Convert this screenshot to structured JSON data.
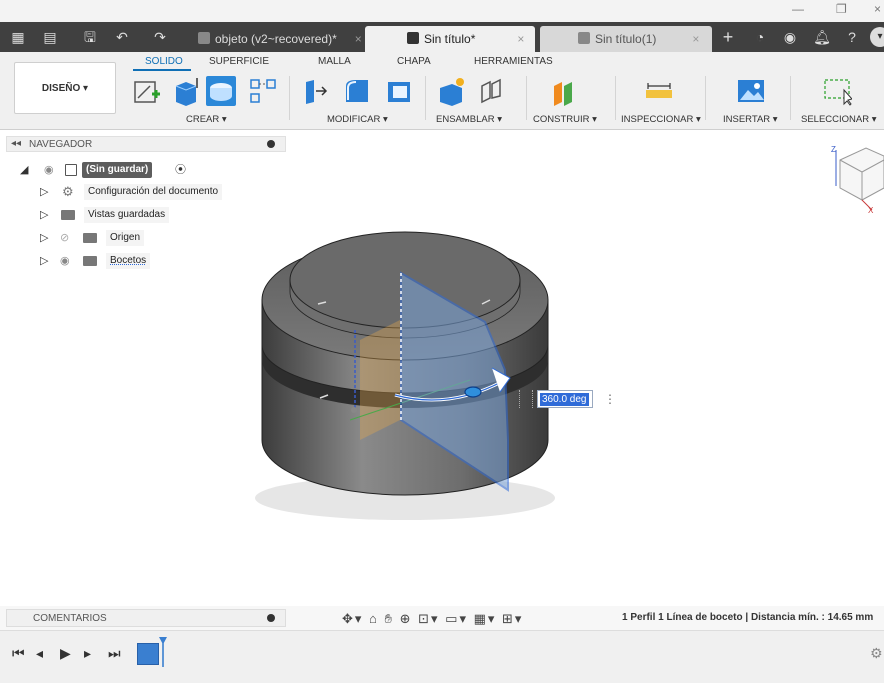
{
  "tabs": [
    {
      "label": "objeto (v2~recovered)*",
      "close": "×"
    },
    {
      "label": "Sin título*",
      "close": "×"
    },
    {
      "label": "Sin título(1)",
      "close": "×"
    }
  ],
  "ribbon": {
    "tabs": [
      "SOLIDO",
      "SUPERFICIE",
      "MALLA",
      "CHAPA",
      "HERRAMIENTAS"
    ],
    "design_button": "DISEÑO ▾",
    "groups": [
      {
        "label": "CREAR ▾"
      },
      {
        "label": "MODIFICAR ▾"
      },
      {
        "label": "ENSAMBLAR ▾"
      },
      {
        "label": "CONSTRUIR ▾"
      },
      {
        "label": "INSPECCIONAR ▾"
      },
      {
        "label": "INSERTAR ▾"
      },
      {
        "label": "SELECCIONAR ▾"
      }
    ]
  },
  "navigator": {
    "title": "NAVEGADOR",
    "root": "(Sin guardar)",
    "items": [
      {
        "label": "Configuración del documento"
      },
      {
        "label": "Vistas guardadas"
      },
      {
        "label": "Origen"
      },
      {
        "label": "Bocetos"
      }
    ]
  },
  "viewport": {
    "dimension_value": "360.0 deg",
    "viewcube_axis_z": "Z",
    "viewcube_axis_x": "X"
  },
  "bottom": {
    "comments_title": "COMENTARIOS",
    "status": "1 Perfil 1 Línea de boceto | Distancia mín. : 14.65 mm"
  },
  "colors": {
    "accent": "#0f6fb5",
    "tabbar": "#404040",
    "selection_blue": "#2f6bd8"
  }
}
